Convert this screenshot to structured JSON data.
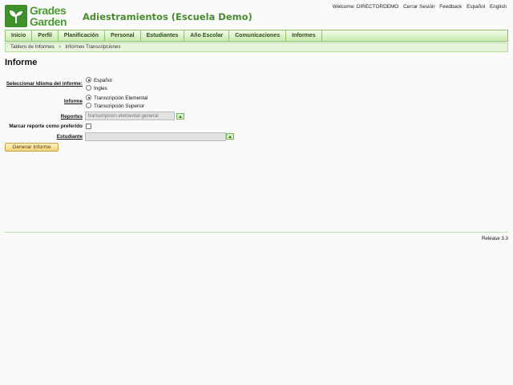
{
  "logo": {
    "line1": "Grades",
    "line2": "Garden"
  },
  "school_name": "Adiestramientos (Escuela Demo)",
  "top_links": {
    "welcome": "Welcome: DIRECTORDEMO",
    "logout": "Cerrar Sesión",
    "feedback": "Feedback",
    "spanish": "Español",
    "english": "English"
  },
  "nav": [
    "Inicio",
    "Perfil",
    "Planificación",
    "Personal",
    "Estudiantes",
    "Año Escolar",
    "Comunicaciones",
    "Informes"
  ],
  "breadcrumb": [
    "Tablero de Informes",
    "Informes Transcripciones"
  ],
  "breadcrumb_sep": ">",
  "page_title": "Informe",
  "form": {
    "language_label": "Seleccionar Idioma del informe:",
    "language_options": [
      "Español",
      "Ingles"
    ],
    "report_label": "Informe",
    "report_options": [
      "Transcripción Elemental",
      "Transcripción Superior"
    ],
    "reports_label": "Reportes",
    "reports_value": "transcripcion elemental general",
    "preferred_label": "Marcar reporte como preferido",
    "student_label": "Estudiante",
    "student_value": "",
    "generate_label": "Generar Informe"
  },
  "footer": {
    "release": "Release 3.3"
  }
}
